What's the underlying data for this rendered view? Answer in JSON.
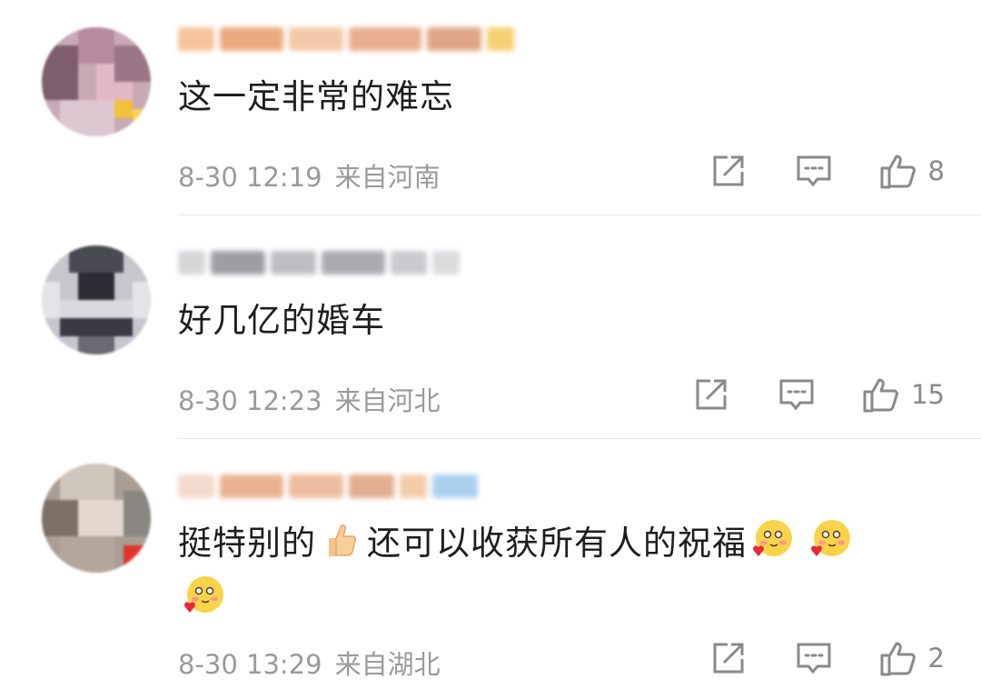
{
  "comments": [
    {
      "text": "这一定非常的难忘",
      "date": "8-30 12:19",
      "location": "来自河南",
      "likes": "8"
    },
    {
      "text": "好几亿的婚车",
      "date": "8-30 12:23",
      "location": "来自河北",
      "likes": "15"
    },
    {
      "text_part1": "挺特别的",
      "text_part2": "还可以收获所有人的祝福",
      "date": "8-30 13:29",
      "location": "来自湖北",
      "likes": "2"
    }
  ],
  "icons": {
    "share": "share-icon",
    "reply": "comment-icon",
    "like": "thumbs-up-icon",
    "emoji_thumb": "thumbs-up-emoji",
    "emoji_face": "blushing-heart-emoji"
  },
  "colors": {
    "meta_gray": "#9a9a9a",
    "icon_gray": "#8a8a8a",
    "divider": "#e8e8e8"
  }
}
